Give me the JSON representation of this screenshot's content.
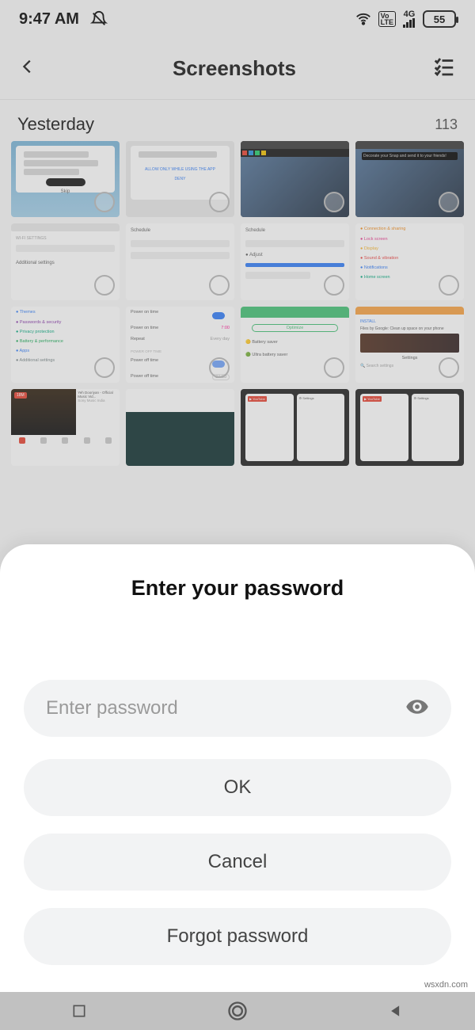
{
  "status": {
    "time": "9:47 AM",
    "battery": "55",
    "network": "4G"
  },
  "header": {
    "title": "Screenshots"
  },
  "section": {
    "label": "Yesterday",
    "count": "113"
  },
  "sheet": {
    "title": "Enter your password",
    "placeholder": "Enter password",
    "ok": "OK",
    "cancel": "Cancel",
    "forgot": "Forgot password"
  },
  "watermark": "wsxdn.com"
}
